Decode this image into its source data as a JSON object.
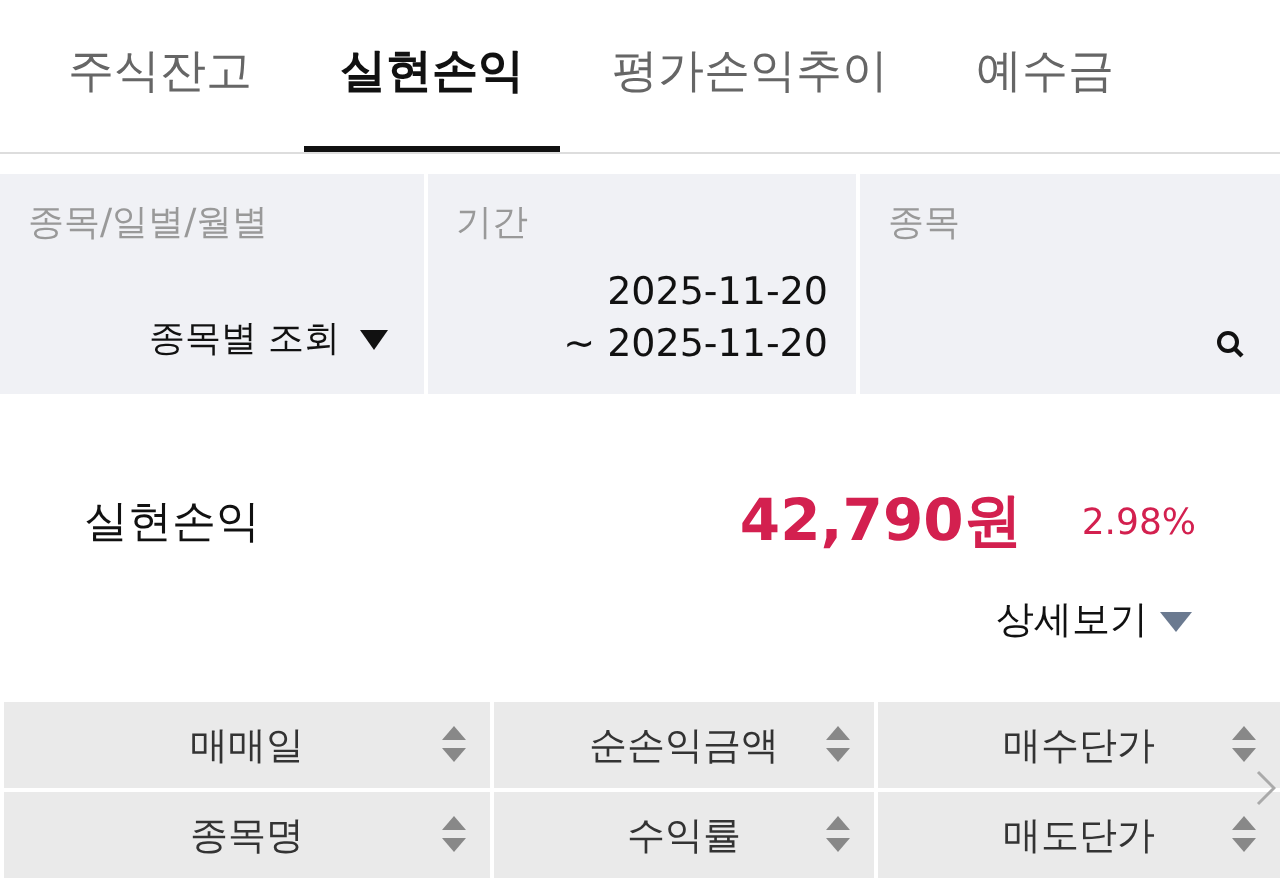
{
  "tabs": [
    {
      "label": "주식잔고",
      "selected": false
    },
    {
      "label": "실현손익",
      "selected": true
    },
    {
      "label": "평가손익추이",
      "selected": false
    },
    {
      "label": "예수금",
      "selected": false
    }
  ],
  "filters": [
    {
      "kind": "dropdown",
      "label": "종목/일별/월별",
      "value": "종목별 조회"
    },
    {
      "kind": "period",
      "label": "기간",
      "from": "2025-11-20",
      "to": "~ 2025-11-20"
    },
    {
      "kind": "search",
      "label": "종목"
    }
  ],
  "summary": {
    "label": "실현손익",
    "amount": "42,790원",
    "rate": "2.98%"
  },
  "detail_link": "상세보기",
  "table": {
    "header_rows": [
      [
        "매매일",
        "순손익금액",
        "매수단가"
      ],
      [
        "종목명",
        "수익률",
        "매도단가"
      ]
    ]
  }
}
